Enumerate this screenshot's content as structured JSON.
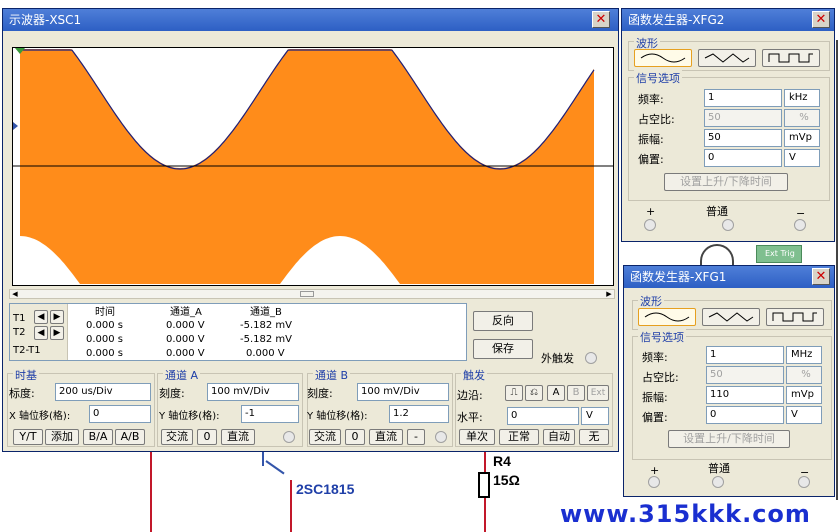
{
  "circuit": {
    "transistor_label": "2SC1815",
    "resistor_name": "R4",
    "resistor_value": "15Ω",
    "watermark": "www.315kkk.com",
    "side_label": "Ext Trig",
    "wire_color": "#c2182a"
  },
  "oscilloscope": {
    "title": "示波器-XSC1",
    "close_glyph": "✕",
    "trace_color": "#ff8c1a",
    "readout": {
      "headers": [
        "时间",
        "通道_A",
        "通道_B"
      ],
      "rows": [
        {
          "label": "T1",
          "time": "0.000 s",
          "a": "0.000 V",
          "b": "-5.182 mV"
        },
        {
          "label": "T2",
          "time": "0.000 s",
          "a": "0.000 V",
          "b": "-5.182 mV"
        },
        {
          "label": "T2-T1",
          "time": "0.000 s",
          "a": "0.000 V",
          "b": "0.000 V"
        }
      ],
      "reverse_button": "反向",
      "save_button": "保存",
      "ext_trigger_label": "外触发"
    },
    "timebase": {
      "title": "时基",
      "scale_label": "标度:",
      "scale_value": "200 us/Div",
      "x_pos_label": "X 轴位移(格):",
      "x_pos_value": "0",
      "buttons": [
        "Y/T",
        "添加",
        "B/A",
        "A/B"
      ]
    },
    "channel_a": {
      "title": "通道 A",
      "scale_label": "刻度:",
      "scale_value": "100 mV/Div",
      "y_pos_label": "Y 轴位移(格):",
      "y_pos_value": "-1",
      "buttons": [
        "交流",
        "0",
        "直流"
      ]
    },
    "channel_b": {
      "title": "通道 B",
      "scale_label": "刻度:",
      "scale_value": "100 mV/Div",
      "y_pos_label": "Y 轴位移(格):",
      "y_pos_value": "1.2",
      "buttons": [
        "交流",
        "0",
        "直流",
        "-"
      ]
    },
    "trigger": {
      "title": "触发",
      "edge_label": "边沿:",
      "edge_buttons": [
        "A",
        "B",
        "Ext"
      ],
      "level_label": "水平:",
      "level_value": "0",
      "level_unit": "V",
      "mode_buttons": [
        "单次",
        "正常",
        "自动",
        "无"
      ]
    }
  },
  "fg2": {
    "title": "函数发生器-XFG2",
    "waveform_label": "波形",
    "signal_label": "信号选项",
    "rows": [
      {
        "label": "频率:",
        "value": "1",
        "unit": "kHz",
        "disabled": false
      },
      {
        "label": "占空比:",
        "value": "50",
        "unit": "%",
        "disabled": true
      },
      {
        "label": "振幅:",
        "value": "50",
        "unit": "mVp",
        "disabled": false
      },
      {
        "label": "偏置:",
        "value": "0",
        "unit": "V",
        "disabled": false
      }
    ],
    "rise_fall_button": "设置上升/下降时间",
    "plus_label": "+",
    "common_label": "普通",
    "minus_label": "−"
  },
  "fg1": {
    "title": "函数发生器-XFG1",
    "waveform_label": "波形",
    "signal_label": "信号选项",
    "rows": [
      {
        "label": "频率:",
        "value": "1",
        "unit": "MHz",
        "disabled": false
      },
      {
        "label": "占空比:",
        "value": "50",
        "unit": "%",
        "disabled": true
      },
      {
        "label": "振幅:",
        "value": "110",
        "unit": "mVp",
        "disabled": false
      },
      {
        "label": "偏置:",
        "value": "0",
        "unit": "V",
        "disabled": false
      }
    ],
    "rise_fall_button": "设置上升/下降时间",
    "plus_label": "+",
    "common_label": "普通",
    "minus_label": "−"
  }
}
